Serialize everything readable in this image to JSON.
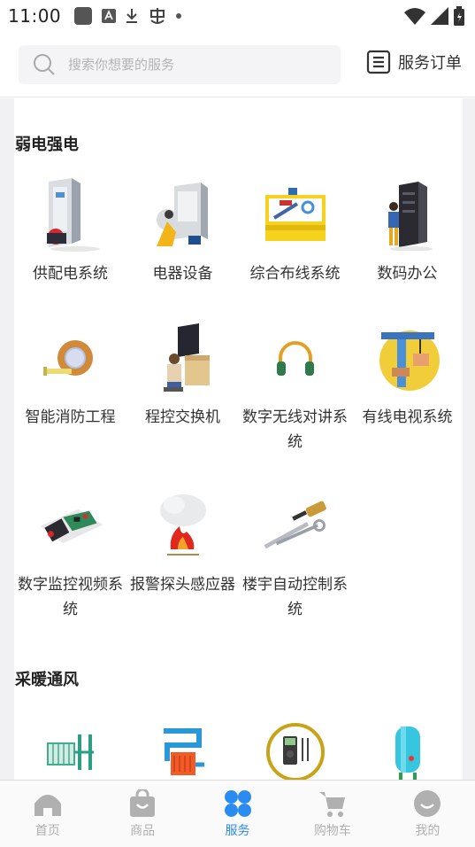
{
  "status_bar": {
    "time": "11:00"
  },
  "header": {
    "search_placeholder": "搜索你想要的服务",
    "orders_label": "服务订单"
  },
  "sections": [
    {
      "title": "弱电强电",
      "items": [
        {
          "label": "供配电系统",
          "icon": "power-distribution-icon"
        },
        {
          "label": "电器设备",
          "icon": "electrical-equipment-icon"
        },
        {
          "label": "综合布线系统",
          "icon": "cabling-toolbox-icon"
        },
        {
          "label": "数码办公",
          "icon": "server-rack-icon"
        },
        {
          "label": "智能消防工程",
          "icon": "tape-measure-icon"
        },
        {
          "label": "程控交换机",
          "icon": "switchboard-operator-icon"
        },
        {
          "label": "数字无线对讲系统",
          "icon": "headphones-icon"
        },
        {
          "label": "有线电视系统",
          "icon": "construction-crane-icon"
        },
        {
          "label": "数字监控视频系统",
          "icon": "circuit-board-icon"
        },
        {
          "label": "报警探头感应器",
          "icon": "fire-smoke-icon"
        },
        {
          "label": "楼宇自动控制系统",
          "icon": "wrench-screwdriver-icon"
        }
      ]
    },
    {
      "title": "采暖通风",
      "items": [
        {
          "label": "",
          "icon": "radiator-icon"
        },
        {
          "label": "",
          "icon": "heating-pipe-icon"
        },
        {
          "label": "",
          "icon": "multimeter-icon"
        },
        {
          "label": "",
          "icon": "water-heater-icon"
        }
      ]
    }
  ],
  "bottom_nav": [
    {
      "label": "首页",
      "icon": "home-icon",
      "active": false
    },
    {
      "label": "商品",
      "icon": "shopping-bag-icon",
      "active": false
    },
    {
      "label": "服务",
      "icon": "services-icon",
      "active": true
    },
    {
      "label": "购物车",
      "icon": "cart-icon",
      "active": false
    },
    {
      "label": "我的",
      "icon": "profile-icon",
      "active": false
    }
  ],
  "colors": {
    "accent": "#2a8cf0",
    "inactive": "#b0b0b0",
    "background": "#f1f1f3"
  }
}
